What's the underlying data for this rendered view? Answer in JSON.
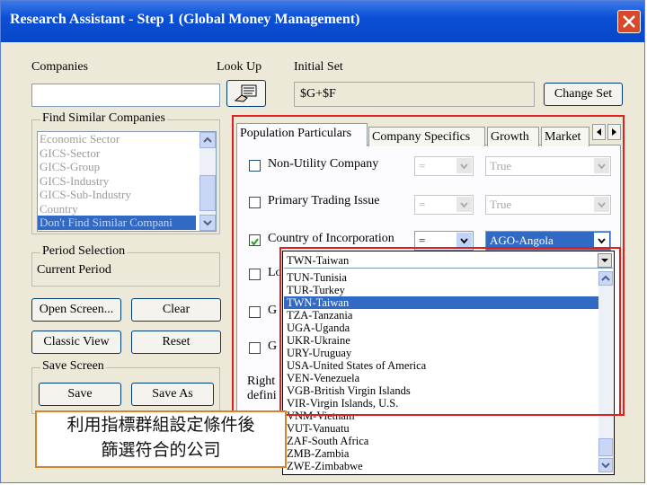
{
  "window": {
    "title": "Research Assistant - Step 1   (Global Money Management)"
  },
  "companies": {
    "label": "Companies",
    "value": ""
  },
  "lookup": {
    "label": "Look Up"
  },
  "initial_set": {
    "label": "Initial Set",
    "value": "$G+$F"
  },
  "change_set": {
    "label": "Change Set"
  },
  "find_similar": {
    "label": "Find Similar Companies",
    "items": [
      "Economic Sector",
      "GICS-Sector",
      "GICS-Group",
      "GICS-Industry",
      "GICS-Sub-Industry",
      "Country",
      "Don't Find Similar Compani"
    ]
  },
  "period": {
    "label": "Period Selection",
    "value": "Current Period"
  },
  "buttons": {
    "open_screen": "Open Screen...",
    "clear": "Clear",
    "classic_view": "Classic View",
    "reset": "Reset",
    "save": "Save",
    "save_as": "Save As"
  },
  "save_screen": {
    "label": "Save Screen"
  },
  "tabs": [
    "Population Particulars",
    "Company Specifics",
    "Growth",
    "Market"
  ],
  "criteria": [
    {
      "label": "Non-Utility Company",
      "checked": false,
      "op": "=",
      "value": "True"
    },
    {
      "label": "Primary Trading Issue",
      "checked": false,
      "op": "=",
      "value": "True"
    },
    {
      "label": "Country of Incorporation",
      "checked": true,
      "op": "=",
      "value": "AGO-Angola"
    },
    {
      "label": "Lo"
    },
    {
      "label": "G"
    },
    {
      "label": "G"
    }
  ],
  "right_text": [
    "Right",
    "defini"
  ],
  "dropdown": {
    "selected": "TWN-Taiwan",
    "items": [
      "TUN-Tunisia",
      "TUR-Turkey",
      "TWN-Taiwan",
      "TZA-Tanzania",
      "UGA-Uganda",
      "UKR-Ukraine",
      "URY-Uruguay",
      "USA-United States of America",
      "VEN-Venezuela",
      "VGB-British Virgin Islands",
      "VIR-Virgin Islands, U.S.",
      "VNM-Vietnam",
      "VUT-Vanuatu",
      "ZAF-South Africa",
      "ZMB-Zambia",
      "ZWE-Zimbabwe"
    ]
  },
  "callout": {
    "line1": "利用指標群組設定條件後",
    "line2": "篩選符合的公司"
  },
  "colors": {
    "title_bar": "#0a4fd6",
    "selection": "#316ac5",
    "highlight": "#e02020",
    "callout_border": "#d9822b"
  }
}
